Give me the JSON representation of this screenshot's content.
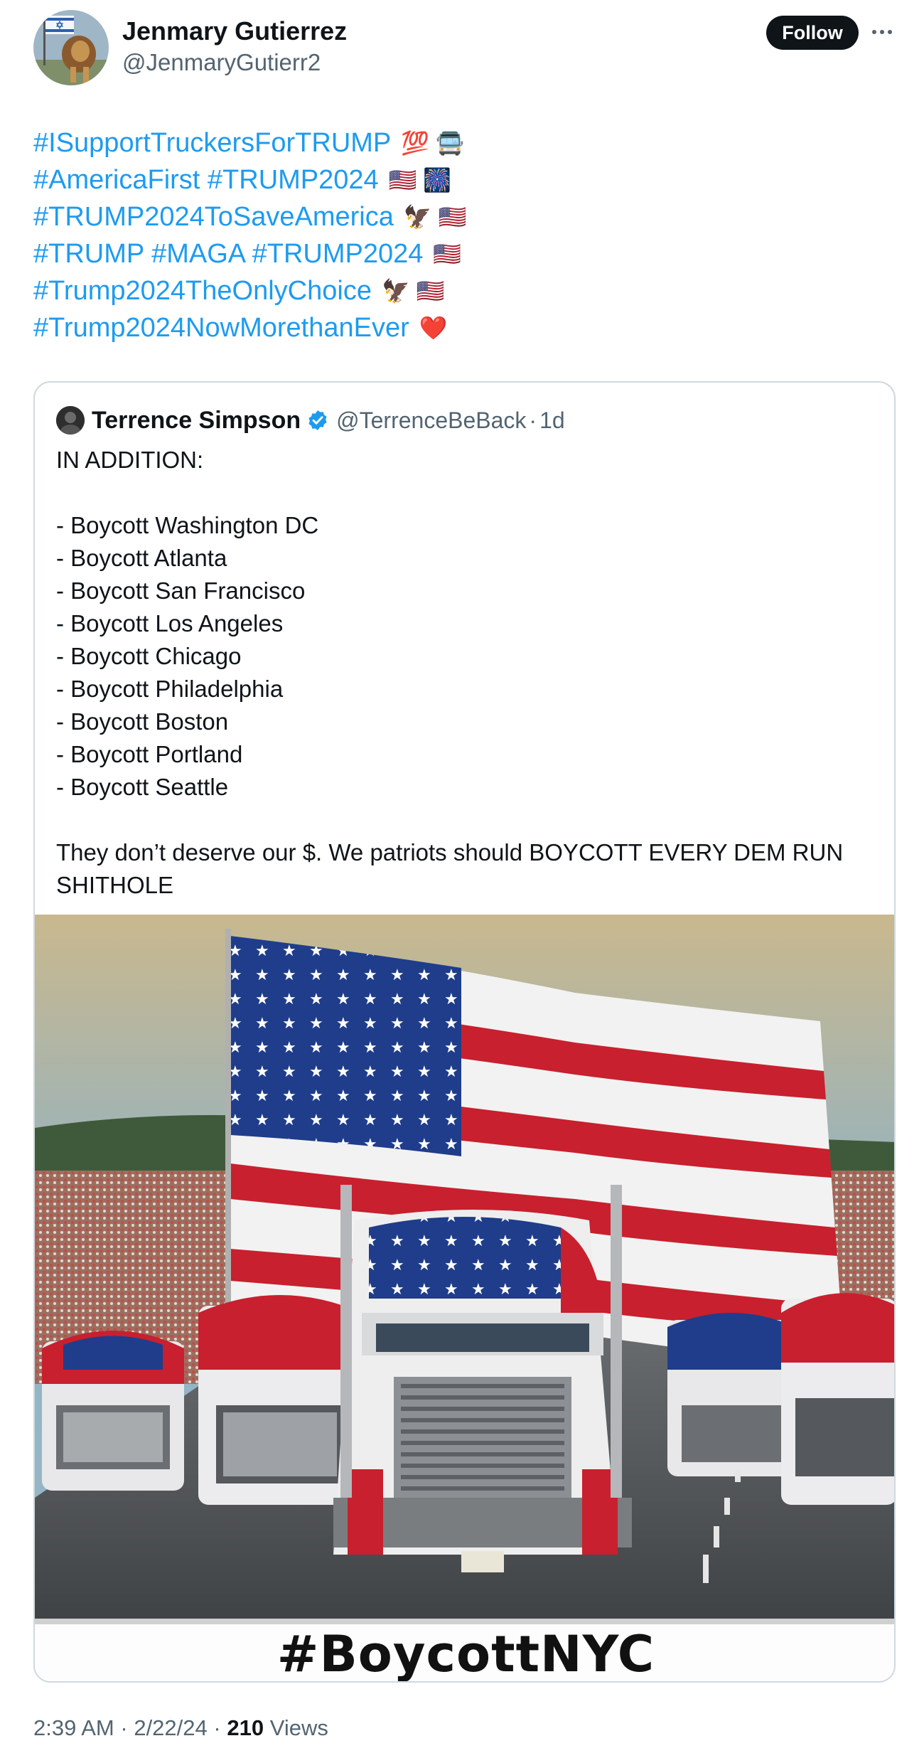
{
  "author": {
    "name": "Jenmary Gutierrez",
    "handle": "@JenmaryGutierr2",
    "follow_label": "Follow"
  },
  "tweet": {
    "lines": [
      {
        "text": "#ISupportTruckersForTRUMP",
        "emoji": "💯 🚍"
      },
      {
        "text": "#AmericaFirst #TRUMP2024",
        "emoji": "🇺🇸 🎆"
      },
      {
        "text": "#TRUMP2024ToSaveAmerica",
        "emoji": "🦅 🇺🇸"
      },
      {
        "text": "#TRUMP #MAGA #TRUMP2024",
        "emoji": "🇺🇸"
      },
      {
        "text": "#Trump2024TheOnlyChoice",
        "emoji": "🦅 🇺🇸"
      },
      {
        "text": "#Trump2024NowMorethanEver",
        "emoji": "❤️"
      }
    ]
  },
  "quote": {
    "name": "Terrence Simpson",
    "handle": "@TerrenceBeBack",
    "separator": "·",
    "time": "1d",
    "body": {
      "intro": "IN ADDITION:",
      "items": [
        "- Boycott Washington DC",
        "- Boycott Atlanta",
        "- Boycott San Francisco",
        "- Boycott Los Angeles",
        "- Boycott Chicago",
        "- Boycott Philadelphia",
        "- Boycott Boston",
        "- Boycott Portland",
        "- Boycott Seattle"
      ],
      "closing": "They don’t deserve our $. We patriots should BOYCOTT EVERY DEM RUN SHITHOLE"
    },
    "image_caption": "#BoycottNYC"
  },
  "meta": {
    "time": "2:39 AM",
    "sep1": "·",
    "date": "2/22/24",
    "sep2": "·",
    "views_count": "210",
    "views_label": "Views"
  },
  "colors": {
    "link": "#1d9bf0",
    "text": "#0f1419",
    "secondary": "#536471",
    "border": "#cfd9de",
    "verified": "#1d9bf0"
  }
}
